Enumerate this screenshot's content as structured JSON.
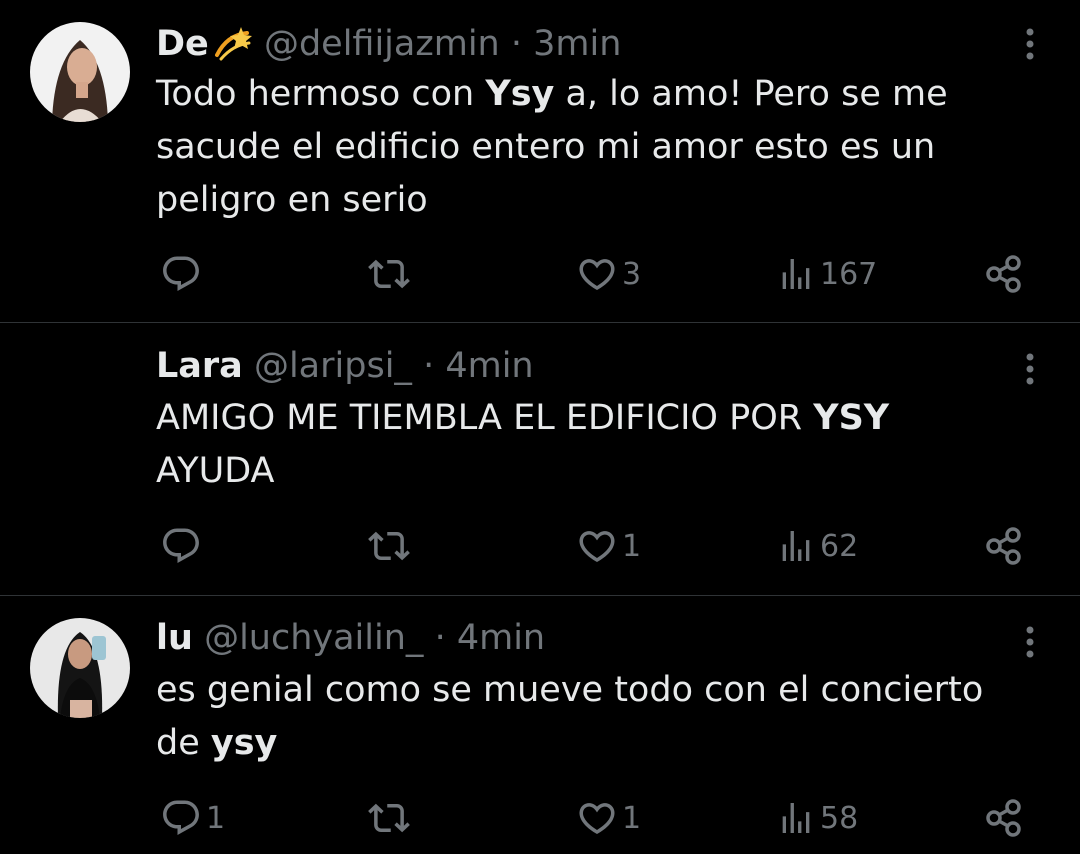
{
  "colors": {
    "background": "#000000",
    "text": "#e7e9ea",
    "muted": "#71767b",
    "divider": "#2f3336"
  },
  "tweets": [
    {
      "name": "De",
      "emoji_icon": "dizzy-star-emoji",
      "handle": "@delfiijazmin",
      "separator": "·",
      "time": "3min",
      "text_before": "Todo hermoso con ",
      "text_bold": "Ysy",
      "text_after": " a, lo amo! Pero se me sacude el edificio entero mi amor esto es un peligro en serio",
      "replies": "",
      "retweets": "",
      "likes": "3",
      "views": "167"
    },
    {
      "name": "Lara",
      "handle": "@laripsi_",
      "separator": "·",
      "time": "4min",
      "text_before": "AMIGO ME TIEMBLA EL EDIFICIO POR ",
      "text_bold": "YSY",
      "text_after": " AYUDA",
      "replies": "",
      "retweets": "",
      "likes": "1",
      "views": "62"
    },
    {
      "name": "lu",
      "handle": "@luchyailin_",
      "separator": "·",
      "time": "4min",
      "text_before": "es genial como se mueve todo con el concierto de ",
      "text_bold": "ysy",
      "text_after": "",
      "replies": "1",
      "retweets": "",
      "likes": "1",
      "views": "58"
    }
  ]
}
